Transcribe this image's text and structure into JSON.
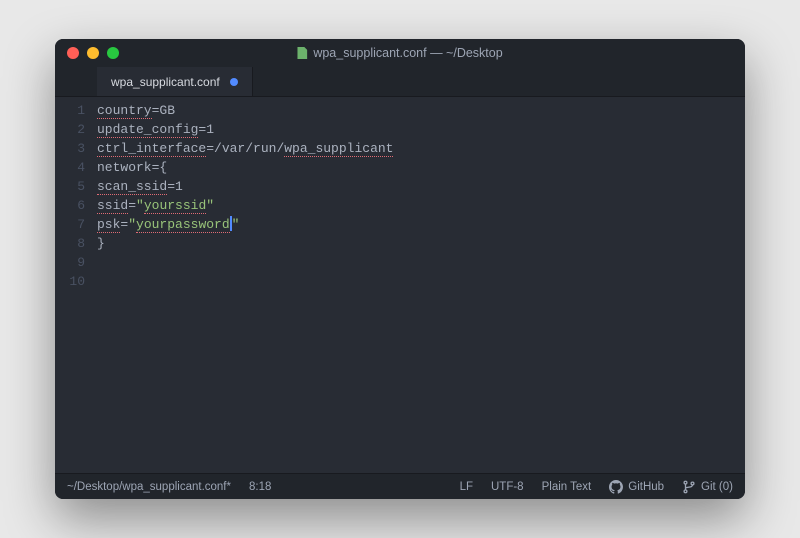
{
  "titlebar": {
    "title": "wpa_supplicant.conf — ~/Desktop"
  },
  "tab": {
    "name": "wpa_supplicant.conf"
  },
  "code": {
    "lines": [
      {
        "n": "1",
        "pre": "country",
        "eq": "=",
        "post": "GB",
        "spellPre": true,
        "spellPost": false
      },
      {
        "n": "2",
        "pre": "update_config",
        "eq": "=",
        "post": "1",
        "spellPre": true,
        "spellPost": false
      },
      {
        "n": "3",
        "pre": "ctrl_interface",
        "eq": "=",
        "post": "/var/run/wpa_supplicant",
        "spellPre": true,
        "spellPost": true,
        "postSpellPart": "wpa_supplicant",
        "postPlainPart": "/var/run/"
      },
      {
        "n": "4",
        "plain": ""
      },
      {
        "n": "5",
        "plain": "network={"
      },
      {
        "n": "6",
        "pre": "scan_ssid",
        "eq": "=",
        "post": "1",
        "spellPre": true,
        "spellPost": false
      },
      {
        "n": "7",
        "pre": "ssid",
        "eq": "=",
        "str": "\"yourssid\"",
        "spellPre": true,
        "spellStr": true,
        "strSpellPart": "yourssid"
      },
      {
        "n": "8",
        "pre": "psk",
        "eq": "=",
        "strOpen": "\"",
        "strBody": "yourpassword",
        "strClose": "\"",
        "spellPre": true,
        "spellStr": true,
        "cursor": true
      },
      {
        "n": "9",
        "plain": "}"
      },
      {
        "n": "10",
        "plain": ""
      }
    ]
  },
  "statusbar": {
    "path": "~/Desktop/wpa_supplicant.conf*",
    "cursor": "8:18",
    "line_ending": "LF",
    "encoding": "UTF-8",
    "grammar": "Plain Text",
    "github": "GitHub",
    "git": "Git (0)"
  }
}
